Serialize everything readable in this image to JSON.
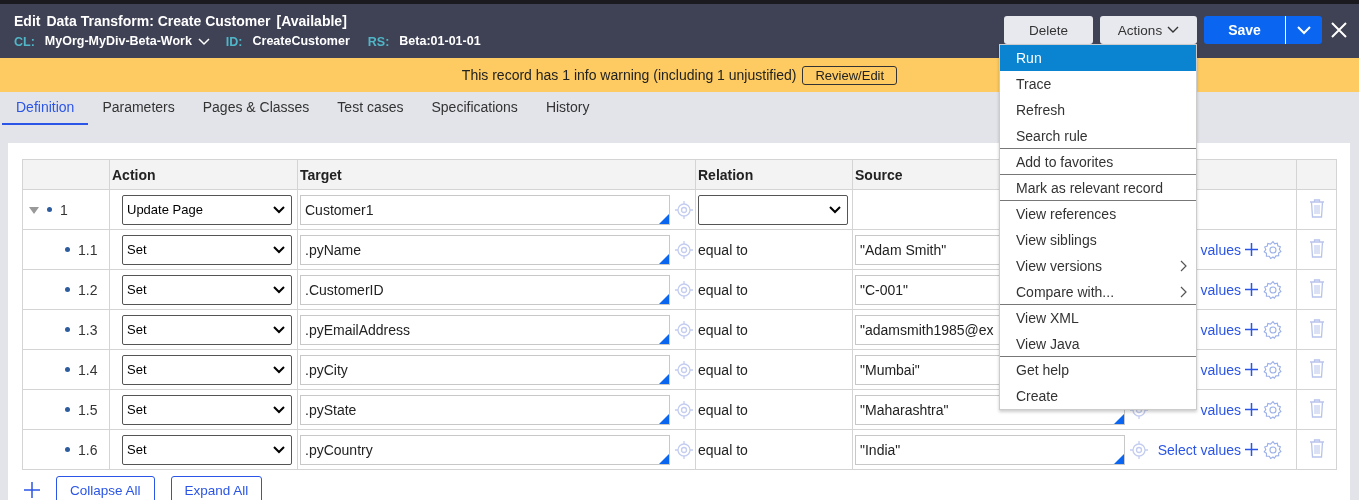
{
  "header": {
    "mode": "Edit",
    "title": "Data Transform: Create Customer",
    "status": "[Available]",
    "meta": [
      {
        "label": "CL:",
        "value": "MyOrg-MyDiv-Beta-Work",
        "dropdown": true
      },
      {
        "label": "ID:",
        "value": "CreateCustomer",
        "dropdown": false
      },
      {
        "label": "RS:",
        "value": "Beta:01-01-01",
        "dropdown": false
      }
    ]
  },
  "buttons": {
    "delete": "Delete",
    "actions": "Actions",
    "save": "Save"
  },
  "actions_menu": [
    {
      "label": "Run",
      "selected": true,
      "submenu": false,
      "separator_after": false
    },
    {
      "label": "Trace",
      "selected": false,
      "submenu": false,
      "separator_after": false
    },
    {
      "label": "Refresh",
      "selected": false,
      "submenu": false,
      "separator_after": false
    },
    {
      "label": "Search rule",
      "selected": false,
      "submenu": false,
      "separator_after": true
    },
    {
      "label": "Add to favorites",
      "selected": false,
      "submenu": false,
      "separator_after": true
    },
    {
      "label": "Mark as relevant record",
      "selected": false,
      "submenu": false,
      "separator_after": true
    },
    {
      "label": "View references",
      "selected": false,
      "submenu": false,
      "separator_after": false
    },
    {
      "label": "View siblings",
      "selected": false,
      "submenu": false,
      "separator_after": false
    },
    {
      "label": "View versions",
      "selected": false,
      "submenu": true,
      "separator_after": false
    },
    {
      "label": "Compare with...",
      "selected": false,
      "submenu": true,
      "separator_after": true
    },
    {
      "label": "View XML",
      "selected": false,
      "submenu": false,
      "separator_after": false
    },
    {
      "label": "View Java",
      "selected": false,
      "submenu": false,
      "separator_after": true
    },
    {
      "label": "Get help",
      "selected": false,
      "submenu": false,
      "separator_after": false
    },
    {
      "label": "Create",
      "selected": false,
      "submenu": false,
      "separator_after": false
    }
  ],
  "warning": {
    "text": "This record has 1 info warning (including 1 unjustified)",
    "button": "Review/Edit"
  },
  "tabs": [
    {
      "label": "Definition",
      "selected": true
    },
    {
      "label": "Parameters",
      "selected": false
    },
    {
      "label": "Pages & Classes",
      "selected": false
    },
    {
      "label": "Test cases",
      "selected": false
    },
    {
      "label": "Specifications",
      "selected": false
    },
    {
      "label": "History",
      "selected": false
    }
  ],
  "table": {
    "columns": [
      "Action",
      "Target",
      "Relation",
      "Source"
    ],
    "rows": [
      {
        "kind": "page",
        "number": "1",
        "expanded": true,
        "action": "Update Page",
        "target": "Customer1",
        "children": [
          {
            "kind": "set",
            "number": "1.1",
            "action": "Set",
            "target": ".pyName",
            "relation": "equal to",
            "source": "\"Adam Smith\"",
            "link": "values"
          },
          {
            "kind": "set",
            "number": "1.2",
            "action": "Set",
            "target": ".CustomerID",
            "relation": "equal to",
            "source": "\"C-001\"",
            "link": "values"
          },
          {
            "kind": "set",
            "number": "1.3",
            "action": "Set",
            "target": ".pyEmailAddress",
            "relation": "equal to",
            "source": "\"adamsmith1985@ex",
            "link": "values"
          },
          {
            "kind": "set",
            "number": "1.4",
            "action": "Set",
            "target": ".pyCity",
            "relation": "equal to",
            "source": "\"Mumbai\"",
            "link": "values"
          },
          {
            "kind": "set",
            "number": "1.5",
            "action": "Set",
            "target": ".pyState",
            "relation": "equal to",
            "source": "\"Maharashtra\"",
            "link": "values"
          },
          {
            "kind": "set",
            "number": "1.6",
            "action": "Set",
            "target": ".pyCountry",
            "relation": "equal to",
            "source": "\"India\"",
            "link": "Select values"
          }
        ]
      }
    ]
  },
  "footer_buttons": [
    "Collapse All",
    "Expand All"
  ]
}
